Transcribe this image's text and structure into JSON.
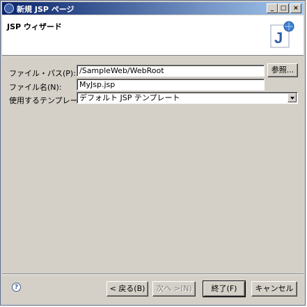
{
  "window": {
    "title": "新規 JSP ページ",
    "controls": {
      "minimize": "_",
      "maximize": "□",
      "close": "×"
    }
  },
  "header": {
    "title": "JSP ウィザード",
    "icon": "jsp-wizard-icon",
    "icon_letter": "J"
  },
  "form": {
    "file_path_label": "ファイル・パス(P):",
    "file_path_value": "/SampleWeb/WebRoot",
    "browse_button": "参照...",
    "file_name_label": "ファイル名(N):",
    "file_name_value": "MyJsp.jsp",
    "template_label": "使用するテンプレート:",
    "template_value": "デフォルト JSP テンプレート"
  },
  "footer": {
    "help_icon": "help-icon",
    "help_glyph": "?",
    "back_button": "< 戻る(B)",
    "next_button": "次へ >(N)",
    "finish_button": "終了(F)",
    "cancel_button": "キャンセル"
  },
  "colors": {
    "title_gradient_start": "#0a246a",
    "title_gradient_end": "#a6caf0",
    "dialog_bg": "#d4d0c8",
    "header_bg": "#ffffff"
  }
}
